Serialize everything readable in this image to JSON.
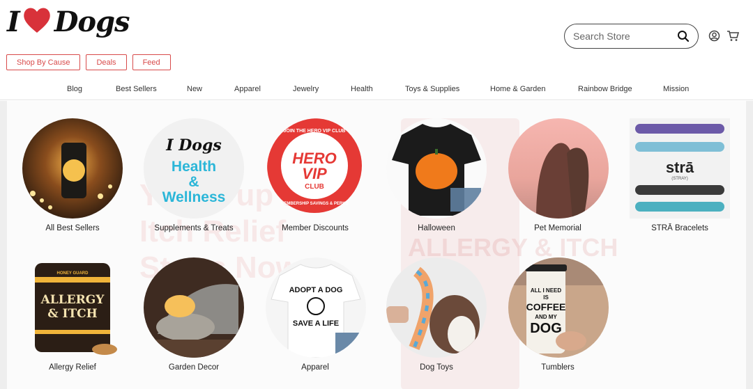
{
  "brand": {
    "logo_text_i": "I",
    "logo_text_dogs": "Dogs"
  },
  "search": {
    "placeholder": "Search Store"
  },
  "pills": [
    "Shop By Cause",
    "Deals",
    "Feed"
  ],
  "nav": [
    "Blog",
    "Best Sellers",
    "New",
    "Apparel",
    "Jewelry",
    "Health",
    "Toys & Supplies",
    "Home & Garden",
    "Rainbow Bridge",
    "Mission"
  ],
  "background_promo": {
    "line1": "Your Pup's",
    "line2": "Itch Relief",
    "line3": "Starts Now",
    "banner": "ALLERGY & ITCH"
  },
  "categories": [
    {
      "label": "All Best Sellers"
    },
    {
      "label": "Supplements & Treats",
      "art_brand": "I Dogs",
      "art_line1": "Health",
      "art_amp": "&",
      "art_line2": "Wellness"
    },
    {
      "label": "Member Discounts",
      "art_top": "JOIN THE HERO VIP CLUB",
      "art_main1": "HERO",
      "art_main2": "VIP",
      "art_club": "CLUB",
      "art_bottom": "MEMBERSHIP SAVINGS & PERKS"
    },
    {
      "label": "Halloween"
    },
    {
      "label": "Pet Memorial"
    },
    {
      "label": "STRĀ Bracelets",
      "art_brand": "strā",
      "art_sub": "(STRAY)"
    },
    {
      "label": "Allergy Relief",
      "art_small": "HONEY GUARD",
      "art_line1": "ALLERGY",
      "art_line2": "& ITCH"
    },
    {
      "label": "Garden Decor"
    },
    {
      "label": "Apparel",
      "art_line1": "ADOPT A DOG",
      "art_line2": "SAVE A LIFE"
    },
    {
      "label": "Dog Toys"
    },
    {
      "label": "Tumblers",
      "art_line1": "ALL I NEED",
      "art_line2": "IS",
      "art_line3": "COFFEE",
      "art_line4": "AND MY",
      "art_line5": "DOG"
    }
  ],
  "colors": {
    "accent": "#d84a4a",
    "nav_text": "#333333",
    "cyan": "#2bb6d8"
  }
}
